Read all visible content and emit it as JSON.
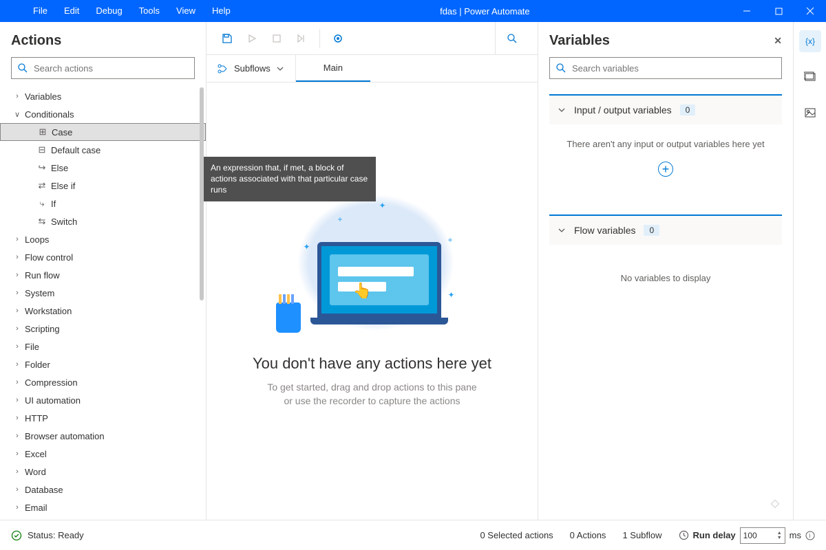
{
  "titlebar": {
    "title": "fdas | Power Automate",
    "menus": [
      "File",
      "Edit",
      "Debug",
      "Tools",
      "View",
      "Help"
    ]
  },
  "actions": {
    "title": "Actions",
    "search_placeholder": "Search actions",
    "categories": [
      {
        "label": "Variables",
        "expanded": false
      },
      {
        "label": "Conditionals",
        "expanded": true,
        "children": [
          {
            "label": "Case",
            "selected": true,
            "icon": "case"
          },
          {
            "label": "Default case",
            "icon": "default-case"
          },
          {
            "label": "Else",
            "icon": "else"
          },
          {
            "label": "Else if",
            "icon": "else-if"
          },
          {
            "label": "If",
            "icon": "if"
          },
          {
            "label": "Switch",
            "icon": "switch"
          }
        ]
      },
      {
        "label": "Loops",
        "expanded": false
      },
      {
        "label": "Flow control",
        "expanded": false
      },
      {
        "label": "Run flow",
        "expanded": false
      },
      {
        "label": "System",
        "expanded": false
      },
      {
        "label": "Workstation",
        "expanded": false
      },
      {
        "label": "Scripting",
        "expanded": false
      },
      {
        "label": "File",
        "expanded": false
      },
      {
        "label": "Folder",
        "expanded": false
      },
      {
        "label": "Compression",
        "expanded": false
      },
      {
        "label": "UI automation",
        "expanded": false
      },
      {
        "label": "HTTP",
        "expanded": false
      },
      {
        "label": "Browser automation",
        "expanded": false
      },
      {
        "label": "Excel",
        "expanded": false
      },
      {
        "label": "Word",
        "expanded": false
      },
      {
        "label": "Database",
        "expanded": false
      },
      {
        "label": "Email",
        "expanded": false
      }
    ],
    "tooltip": "An expression that, if met, a block of actions associated with that particular case runs"
  },
  "center": {
    "subflows_label": "Subflows",
    "tab_main": "Main",
    "empty_title": "You don't have any actions here yet",
    "empty_line1": "To get started, drag and drop actions to this pane",
    "empty_line2": "or use the recorder to capture the actions"
  },
  "variables": {
    "title": "Variables",
    "search_placeholder": "Search variables",
    "io_label": "Input / output variables",
    "io_count": "0",
    "io_empty": "There aren't any input or output variables here yet",
    "flow_label": "Flow variables",
    "flow_count": "0",
    "flow_empty": "No variables to display"
  },
  "status": {
    "ready": "Status: Ready",
    "selected": "0 Selected actions",
    "actions": "0 Actions",
    "subflows": "1 Subflow",
    "delay_label": "Run delay",
    "delay_value": "100",
    "delay_unit": "ms"
  }
}
